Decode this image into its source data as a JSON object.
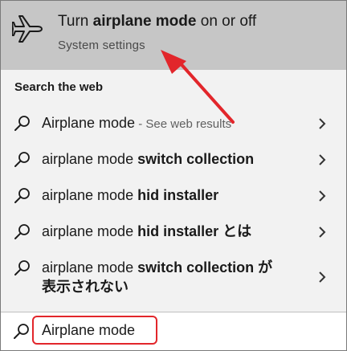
{
  "best_match": {
    "title_prefix": "Turn ",
    "title_bold": "airplane mode",
    "title_suffix": " on or off",
    "subtitle": "System settings",
    "icon": "airplane-icon"
  },
  "section_header": "Search the web",
  "results": [
    {
      "normal": "Airplane mode",
      "bold": "",
      "hint": " - See web results"
    },
    {
      "normal": "airplane mode ",
      "bold": "switch collection",
      "hint": ""
    },
    {
      "normal": "airplane mode ",
      "bold": "hid installer",
      "hint": ""
    },
    {
      "normal": "airplane mode ",
      "bold": "hid installer とは",
      "hint": ""
    },
    {
      "normal": "airplane mode ",
      "bold": "switch collection が 表示されない",
      "hint": ""
    }
  ],
  "search": {
    "value": "Airplane mode",
    "icon": "search-icon"
  },
  "colors": {
    "highlight_bg": "#c6c6c6",
    "annotation_red": "#e2262b"
  }
}
